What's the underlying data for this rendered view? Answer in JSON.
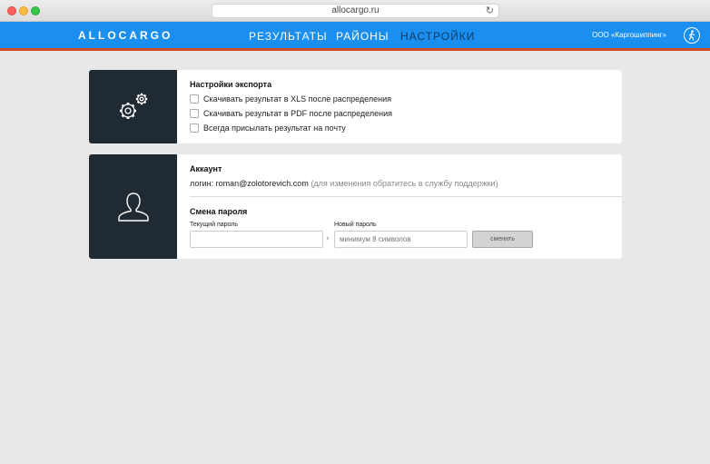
{
  "browser": {
    "url": "allocargo.ru"
  },
  "nav": {
    "logo": "ALLOCARGO",
    "items": [
      {
        "label": "РЕЗУЛЬТАТЫ"
      },
      {
        "label": "РАЙОНЫ"
      },
      {
        "label": "НАСТРОЙКИ"
      }
    ],
    "active_item": "НАСТРОЙКИ",
    "company": "ООО «Каргошиппинг»"
  },
  "export_settings": {
    "icon": "gears-icon",
    "title": "Настройки экспорта",
    "options": [
      {
        "label": "Скачивать результат в XLS после распределения",
        "checked": false
      },
      {
        "label": "Скачивать результат в PDF после распределения",
        "checked": false
      },
      {
        "label": "Всегда присылать результат на почту",
        "checked": false
      }
    ]
  },
  "account": {
    "icon": "user-icon",
    "title": "Аккаунт",
    "login_prefix": "логин: ",
    "login": "roman@zolotorevich.com",
    "login_note": " (для изменения обратитесь в службу поддержки)",
    "password_section_title": "Смена пароля",
    "current_password_label": "Текущий пароль",
    "current_password_value": "",
    "new_password_label": "Новый пароль",
    "new_password_placeholder": "минимум 8 символов",
    "submit_label": "сменить"
  },
  "colors": {
    "nav_bg": "#1a8ff0",
    "nav_border": "#d34a2a",
    "card_side": "#1f2a33",
    "page_bg": "#e8e8e8"
  }
}
